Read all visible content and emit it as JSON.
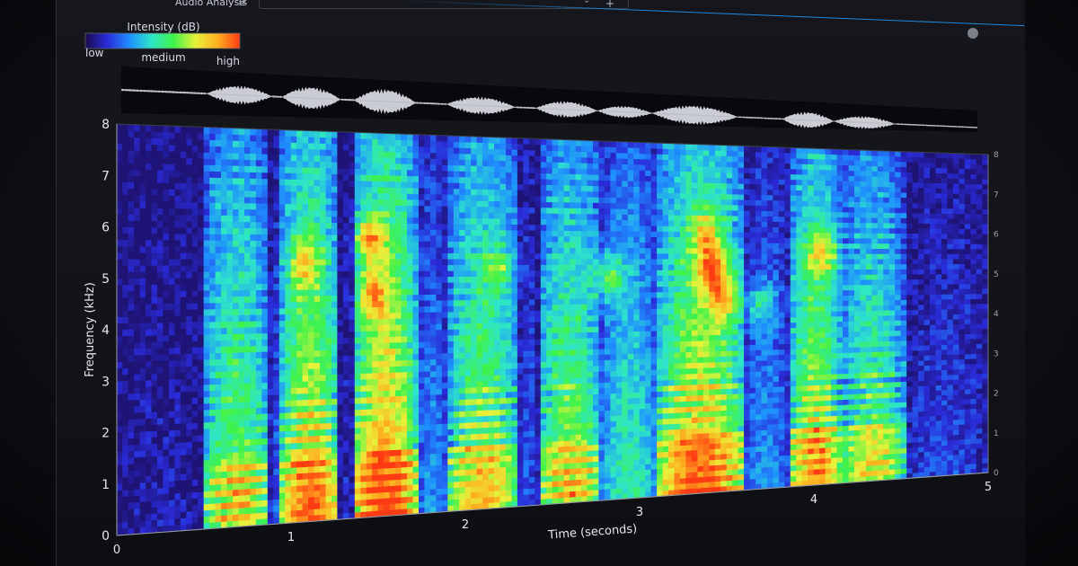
{
  "window": {
    "title": "Audio Analysis",
    "menu_icon": "hamburger-icon",
    "add_tab_icon": "plus-icon",
    "dropdown_icon": "chevron-down-icon",
    "accent_color": "#1f8ae0"
  },
  "legend": {
    "title": "Intensity (dB)",
    "low_label": "low",
    "medium_label": "medium",
    "high_label": "high",
    "colormap": [
      "#1b0b4f",
      "#2a2bd8",
      "#1f8fff",
      "#2ee6c8",
      "#3ff24a",
      "#e8f23a",
      "#ffae1f",
      "#ff3b14"
    ]
  },
  "chart_data": {
    "type": "heatmap",
    "title": "",
    "xlabel": "Time (seconds)",
    "ylabel": "Frequency (kHz)",
    "xlim": [
      0,
      5
    ],
    "ylim": [
      0,
      8
    ],
    "x_ticks": [
      "0",
      "1",
      "2",
      "3",
      "4",
      "5"
    ],
    "y_ticks": [
      "0",
      "1",
      "2",
      "3",
      "4",
      "5",
      "6",
      "7",
      "8"
    ],
    "right_y_ticks": [
      "0",
      "1",
      "2",
      "3",
      "4",
      "5",
      "6",
      "7",
      "8"
    ],
    "grid": false,
    "waveform_shown": true,
    "segments": [
      {
        "start": 0.0,
        "end": 0.5,
        "level": 0.1,
        "pulse": false
      },
      {
        "start": 0.5,
        "end": 0.88,
        "level": 0.62,
        "pulse": true
      },
      {
        "start": 0.88,
        "end": 0.94,
        "level": 0.22,
        "pulse": false
      },
      {
        "start": 0.94,
        "end": 1.28,
        "level": 0.78,
        "pulse": true
      },
      {
        "start": 1.28,
        "end": 1.36,
        "level": 0.12,
        "pulse": false
      },
      {
        "start": 1.36,
        "end": 1.72,
        "level": 0.88,
        "pulse": true
      },
      {
        "start": 1.72,
        "end": 1.9,
        "level": 0.3,
        "pulse": false
      },
      {
        "start": 1.9,
        "end": 2.3,
        "level": 0.66,
        "pulse": true
      },
      {
        "start": 2.3,
        "end": 2.42,
        "level": 0.2,
        "pulse": false
      },
      {
        "start": 2.42,
        "end": 2.78,
        "level": 0.64,
        "pulse": true
      },
      {
        "start": 2.78,
        "end": 3.1,
        "level": 0.48,
        "pulse": false
      },
      {
        "start": 3.1,
        "end": 3.6,
        "level": 0.8,
        "pulse": true
      },
      {
        "start": 3.6,
        "end": 3.86,
        "level": 0.3,
        "pulse": false
      },
      {
        "start": 3.86,
        "end": 4.16,
        "level": 0.72,
        "pulse": true
      },
      {
        "start": 4.16,
        "end": 4.52,
        "level": 0.58,
        "pulse": true
      },
      {
        "start": 4.52,
        "end": 5.0,
        "level": 0.18,
        "pulse": false
      }
    ],
    "hotspots": [
      {
        "t": 1.45,
        "f": 5.8,
        "v": 0.85
      },
      {
        "t": 1.47,
        "f": 4.6,
        "v": 0.7
      },
      {
        "t": 1.08,
        "f": 5.3,
        "v": 0.7
      },
      {
        "t": 2.82,
        "f": 5.0,
        "v": 0.72
      },
      {
        "t": 3.42,
        "f": 5.2,
        "v": 0.95
      },
      {
        "t": 3.48,
        "f": 4.5,
        "v": 0.85
      },
      {
        "t": 3.38,
        "f": 6.0,
        "v": 0.7
      },
      {
        "t": 4.05,
        "f": 5.5,
        "v": 0.8
      },
      {
        "t": 2.2,
        "f": 5.2,
        "v": 0.5
      },
      {
        "t": 3.7,
        "f": 4.3,
        "v": 0.55
      }
    ]
  }
}
